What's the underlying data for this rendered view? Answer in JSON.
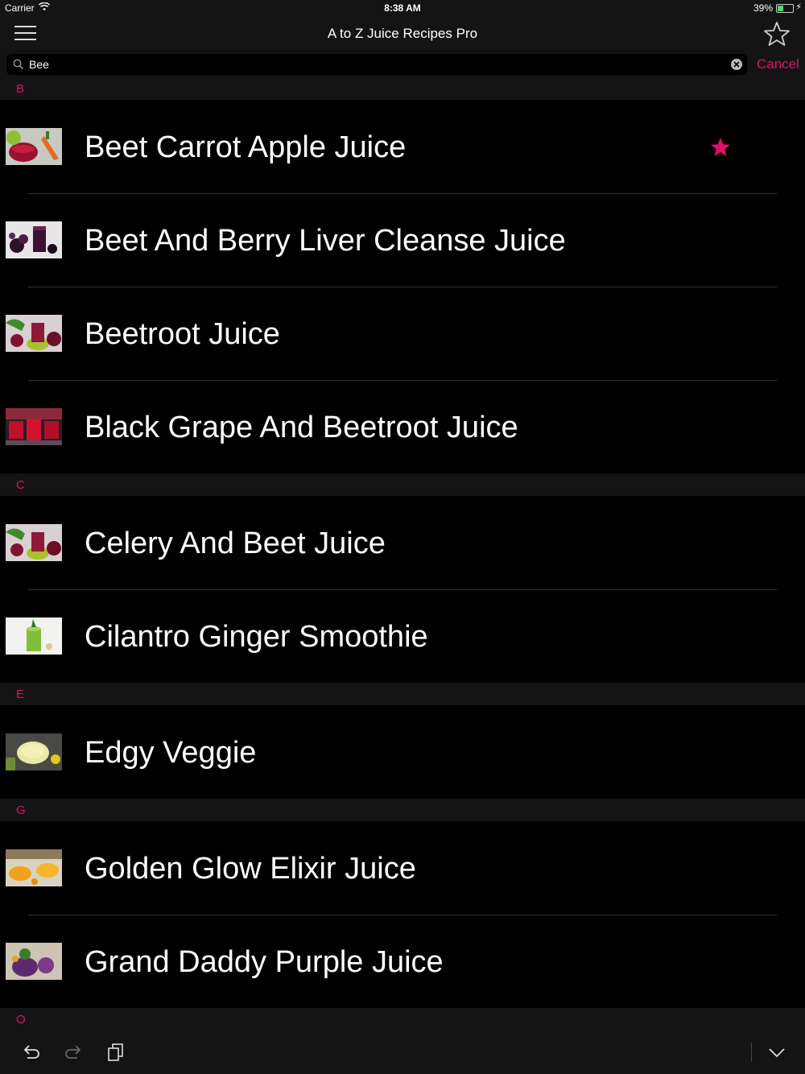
{
  "status_bar": {
    "carrier": "Carrier",
    "time": "8:38 AM",
    "battery": "39%",
    "battery_level": 0.39
  },
  "nav": {
    "title": "A to Z Juice Recipes Pro",
    "menu_icon": "hamburger-menu-icon",
    "favorites_icon": "star-outline-icon"
  },
  "search": {
    "value": "Bee",
    "cancel_label": "Cancel"
  },
  "accent_color": "#e0106a",
  "sections": [
    {
      "letter": "B",
      "items": [
        {
          "label": "Beet Carrot Apple Juice",
          "favorite": true
        },
        {
          "label": "Beet And Berry Liver Cleanse Juice",
          "favorite": false
        },
        {
          "label": "Beetroot Juice",
          "favorite": false
        },
        {
          "label": "Black Grape And Beetroot Juice",
          "favorite": false
        }
      ]
    },
    {
      "letter": "C",
      "items": [
        {
          "label": "Celery And Beet Juice",
          "favorite": false
        },
        {
          "label": "Cilantro Ginger Smoothie",
          "favorite": false
        }
      ]
    },
    {
      "letter": "E",
      "items": [
        {
          "label": "Edgy Veggie",
          "favorite": false
        }
      ]
    },
    {
      "letter": "G",
      "items": [
        {
          "label": "Golden Glow Elixir Juice",
          "favorite": false
        },
        {
          "label": "Grand Daddy Purple Juice",
          "favorite": false
        }
      ]
    },
    {
      "letter": "O",
      "items": []
    }
  ],
  "toolbar": {
    "icons": [
      "undo-icon",
      "redo-icon",
      "clipboard-icon",
      "chevron-down-icon"
    ]
  }
}
